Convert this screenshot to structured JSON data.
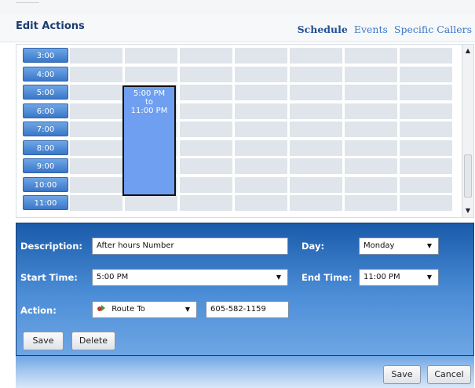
{
  "header": {
    "title": "Edit Actions",
    "tabs": [
      {
        "label": "Schedule",
        "active": true
      },
      {
        "label": "Events",
        "active": false
      },
      {
        "label": "Specific Callers",
        "active": false
      }
    ]
  },
  "calendar": {
    "times": [
      "3:00",
      "4:00",
      "5:00",
      "6:00",
      "7:00",
      "8:00",
      "9:00",
      "10:00",
      "11:00"
    ],
    "event": {
      "start": "5:00 PM",
      "connector": "to",
      "end": "11:00 PM"
    }
  },
  "form": {
    "description_label": "Description:",
    "description_value": "After hours Number",
    "day_label": "Day:",
    "day_value": "Monday",
    "start_label": "Start Time:",
    "start_value": "5:00 PM",
    "end_label": "End Time:",
    "end_value": "11:00 PM",
    "action_label": "Action:",
    "action_value": "Route To",
    "phone_value": "605-582-1159",
    "save_label": "Save",
    "delete_label": "Delete"
  },
  "footer": {
    "save_label": "Save",
    "cancel_label": "Cancel"
  },
  "colors": {
    "panel": "#195baa",
    "time_label": "#3a77c9",
    "event": "#6e9ff0"
  }
}
